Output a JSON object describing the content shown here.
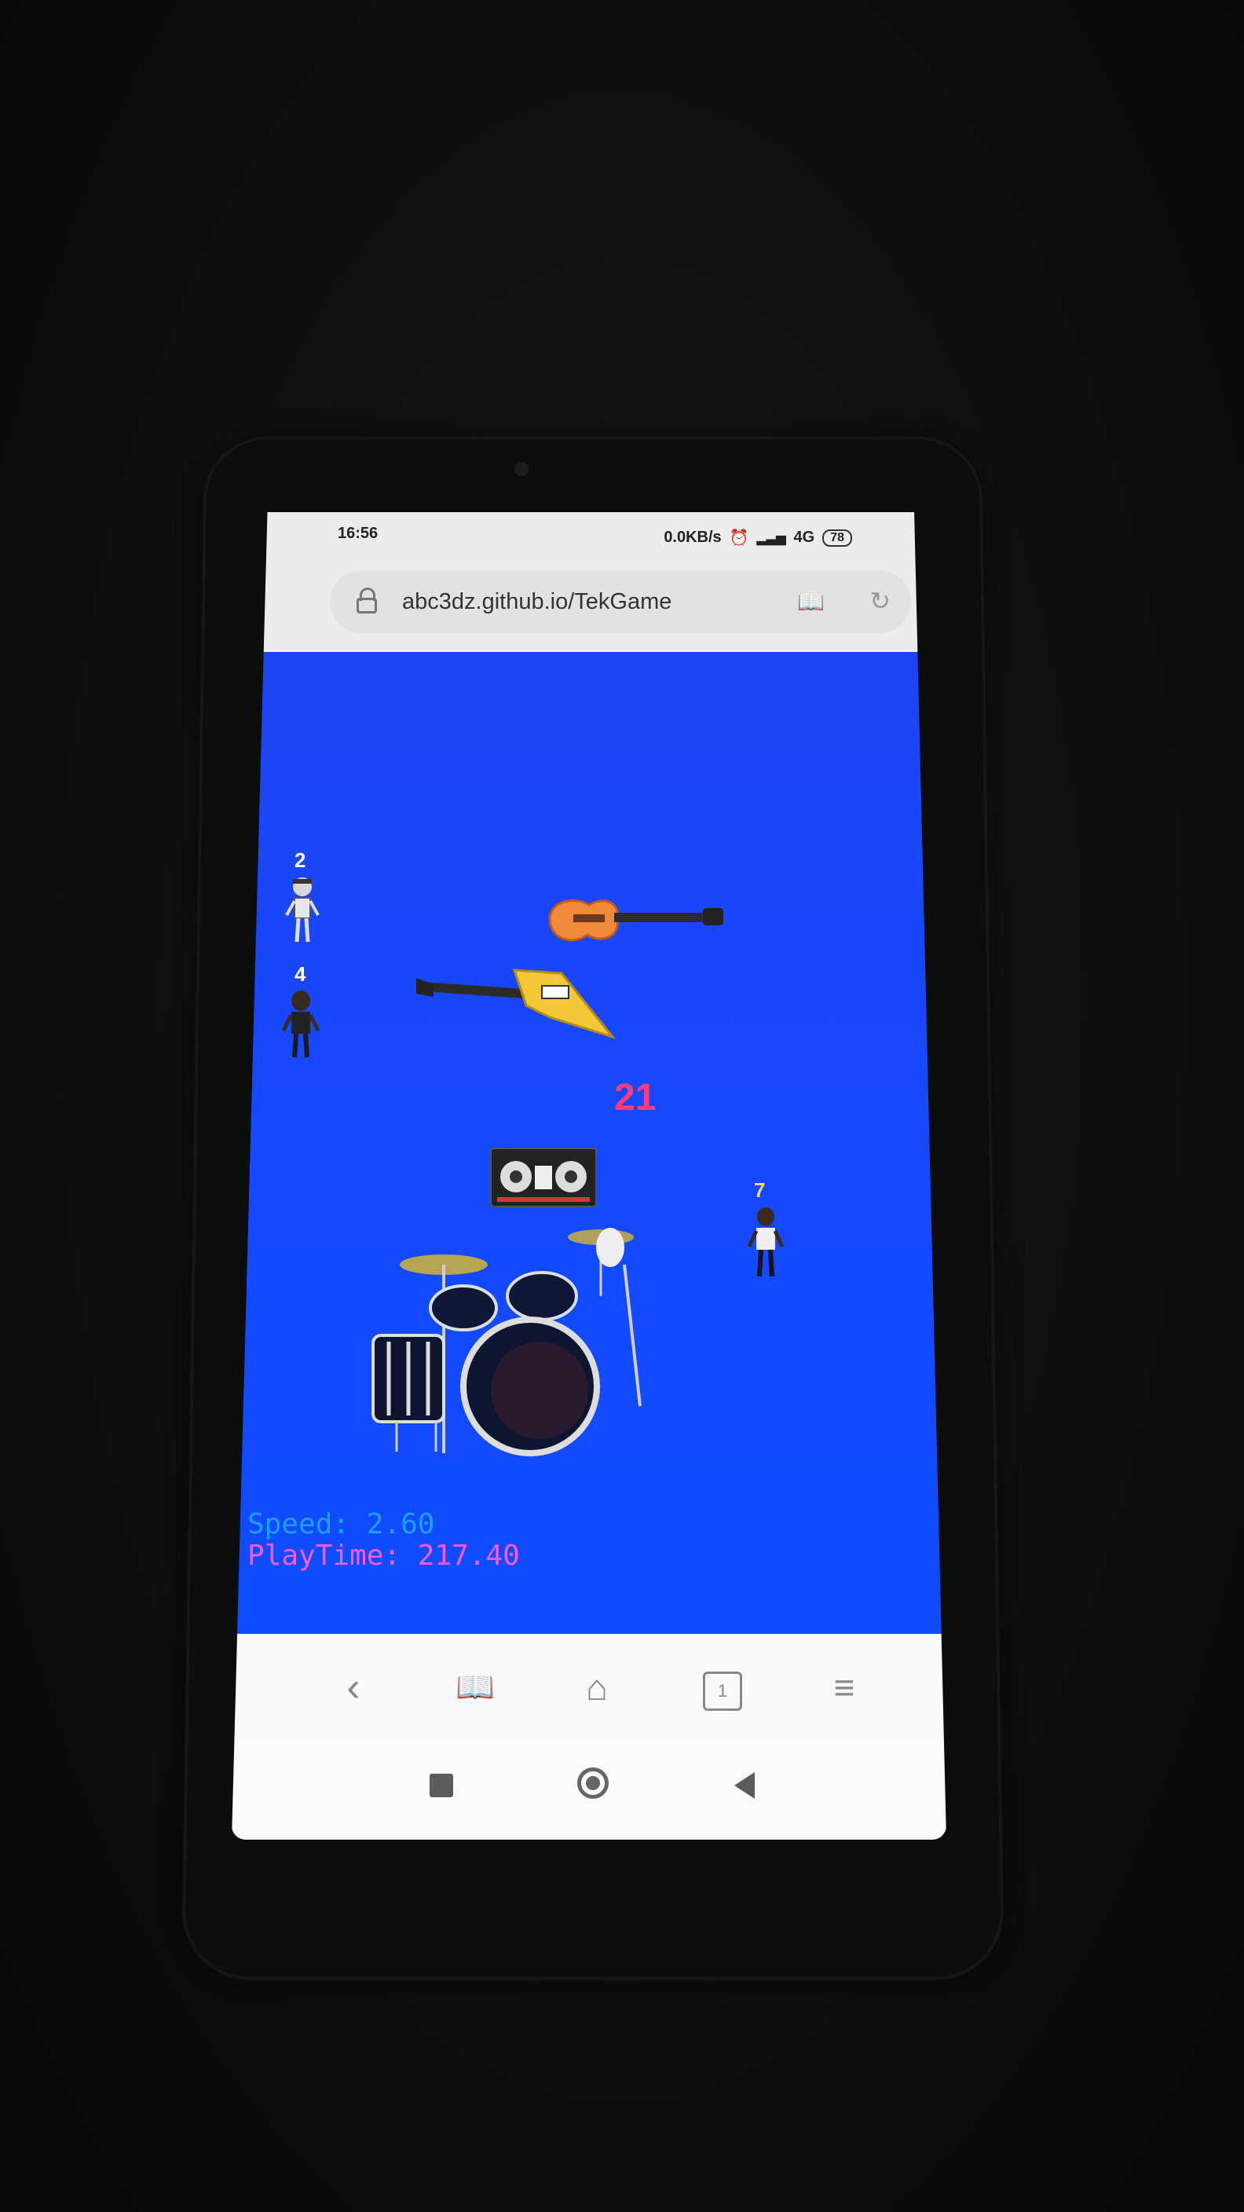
{
  "status": {
    "time": "16:56",
    "net_speed": "0.0KB/s",
    "network": "4G",
    "battery": "78"
  },
  "browser": {
    "url": "abc3dz.github.io/TekGame"
  },
  "game": {
    "players": [
      {
        "label": "2"
      },
      {
        "label": "4"
      },
      {
        "label": "7"
      }
    ],
    "score": "21",
    "hud": {
      "speed": "Speed: 2.60",
      "playtime": "PlayTime: 217.40"
    }
  },
  "navbar": {
    "tabs_count": "1"
  },
  "colors": {
    "game_bg": "#1549ff",
    "score": "#ff3b7a",
    "speed": "#1ea0ff",
    "playtime": "#ff5ad2"
  }
}
